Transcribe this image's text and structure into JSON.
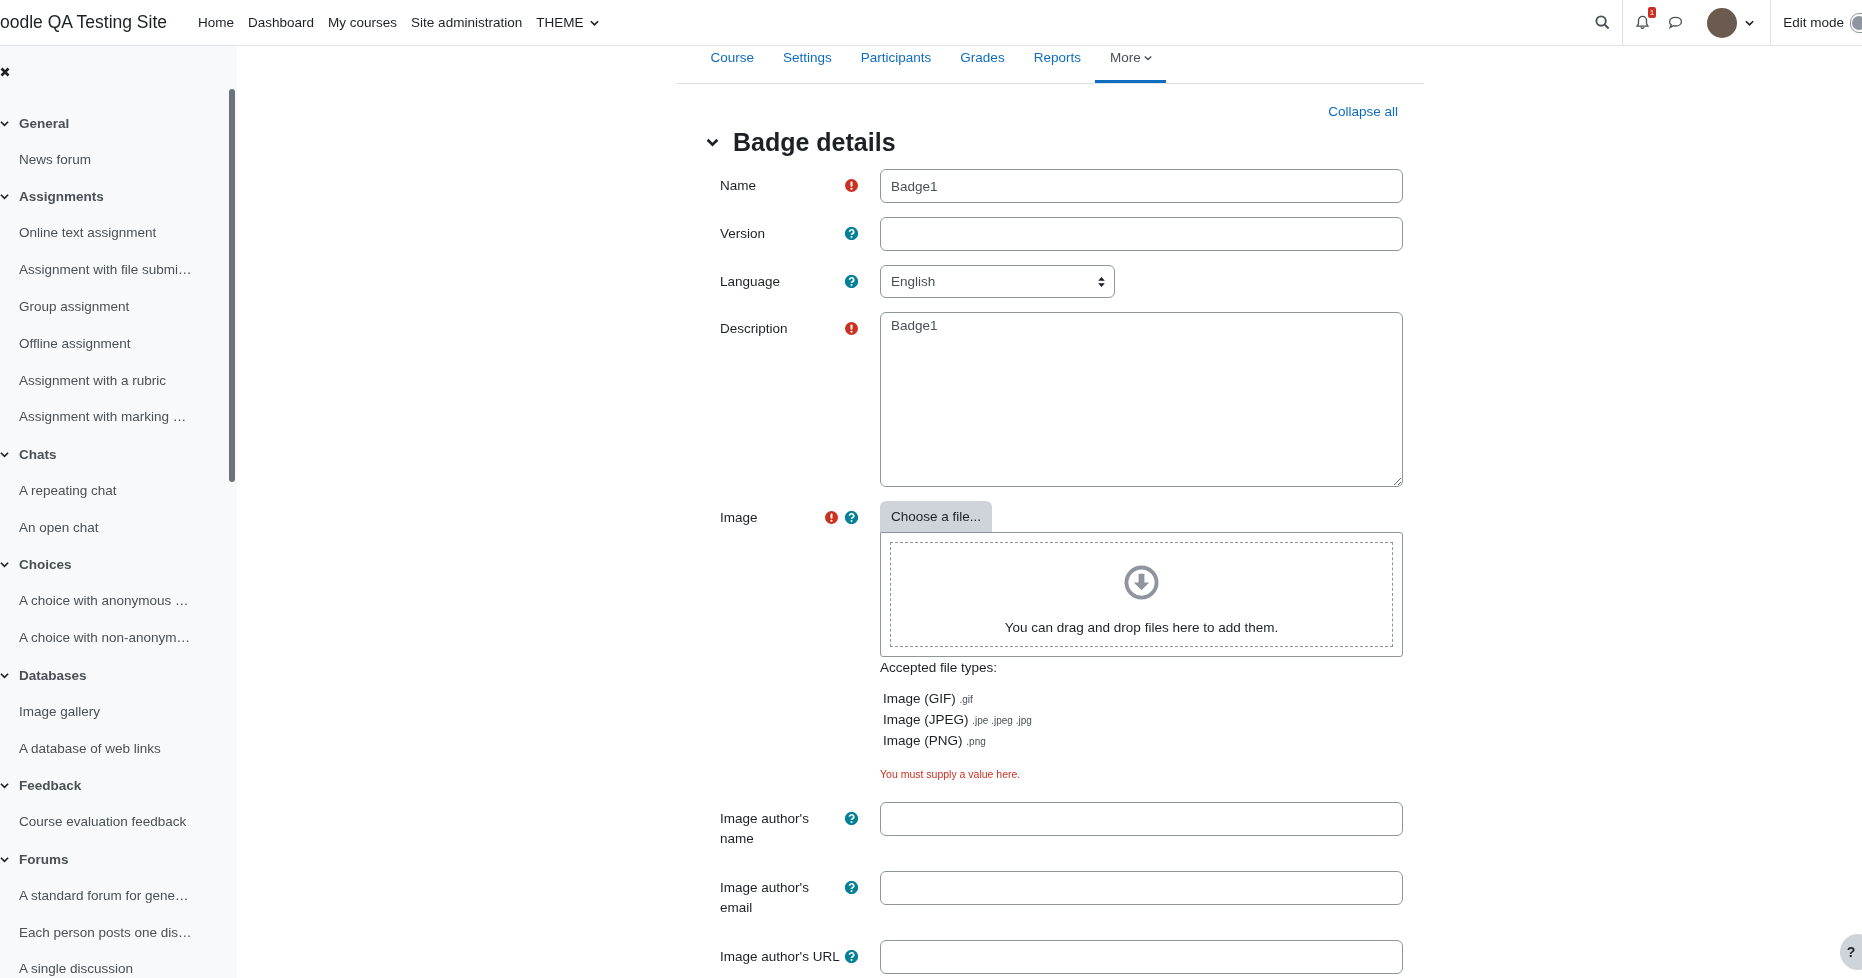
{
  "navbar": {
    "site_name": "oodle QA Testing Site",
    "links": [
      {
        "label": "Home",
        "dropdown": false
      },
      {
        "label": "Dashboard",
        "dropdown": false
      },
      {
        "label": "My courses",
        "dropdown": false
      },
      {
        "label": "Site administration",
        "dropdown": false
      },
      {
        "label": "THEME",
        "dropdown": true
      }
    ],
    "notification_count": "1",
    "edit_mode": {
      "label": "Edit mode",
      "on": false
    }
  },
  "sidebar": {
    "sections": [
      {
        "title": "General",
        "expanded": true,
        "children": [
          {
            "label": "News forum"
          }
        ]
      },
      {
        "title": "Assignments",
        "expanded": true,
        "children": [
          {
            "label": "Online text assignment"
          },
          {
            "label": "Assignment with file submi…"
          },
          {
            "label": "Group assignment"
          },
          {
            "label": "Offline assignment"
          },
          {
            "label": "Assignment with a rubric"
          },
          {
            "label": "Assignment with marking …"
          }
        ]
      },
      {
        "title": "Chats",
        "expanded": true,
        "children": [
          {
            "label": "A repeating chat"
          },
          {
            "label": "An open chat"
          }
        ]
      },
      {
        "title": "Choices",
        "expanded": true,
        "children": [
          {
            "label": "A choice with anonymous …"
          },
          {
            "label": "A choice with non-anonym…"
          }
        ]
      },
      {
        "title": "Databases",
        "expanded": true,
        "children": [
          {
            "label": "Image gallery"
          },
          {
            "label": "A database of web links"
          }
        ]
      },
      {
        "title": "Feedback",
        "expanded": true,
        "children": [
          {
            "label": "Course evaluation feedback"
          }
        ]
      },
      {
        "title": "Forums",
        "expanded": true,
        "children": [
          {
            "label": "A standard forum for gene…"
          },
          {
            "label": "Each person posts one dis…"
          },
          {
            "label": "A single discussion"
          }
        ]
      }
    ]
  },
  "tabs": [
    {
      "label": "Course",
      "selected": false,
      "dropdown": false
    },
    {
      "label": "Settings",
      "selected": false,
      "dropdown": false
    },
    {
      "label": "Participants",
      "selected": false,
      "dropdown": false
    },
    {
      "label": "Grades",
      "selected": false,
      "dropdown": false
    },
    {
      "label": "Reports",
      "selected": false,
      "dropdown": false
    },
    {
      "label": "More",
      "selected": true,
      "dropdown": true
    }
  ],
  "collapse_all": "Collapse all",
  "section": {
    "title": "Badge details",
    "expanded": true,
    "fields": [
      {
        "kind": "text",
        "label": "Name",
        "required": true,
        "help": false,
        "value": "Badge1"
      },
      {
        "kind": "text",
        "label": "Version",
        "required": false,
        "help": true
      },
      {
        "kind": "select",
        "label": "Language",
        "required": false,
        "help": true,
        "value": "English"
      },
      {
        "kind": "textarea",
        "label": "Description",
        "required": true,
        "help": false,
        "value": "Badge1"
      },
      {
        "kind": "filepicker",
        "label": "Image",
        "required": true,
        "help": true,
        "button": "Choose a file...",
        "drop_text": "You can drag and drop files here to add them.",
        "accepted_label": "Accepted file types:",
        "types": [
          {
            "name": "Image (GIF)",
            "ext": ".gif"
          },
          {
            "name": "Image (JPEG)",
            "ext": ".jpe .jpeg .jpg"
          },
          {
            "name": "Image (PNG)",
            "ext": ".png"
          }
        ],
        "error": "You must supply a value here."
      },
      {
        "kind": "text",
        "label": "Image author's name",
        "required": false,
        "help": true
      },
      {
        "kind": "text",
        "label": "Image author's email",
        "required": false,
        "help": true
      },
      {
        "kind": "text",
        "label": "Image author's URL",
        "required": false,
        "help": true
      }
    ]
  },
  "help_button": "?"
}
